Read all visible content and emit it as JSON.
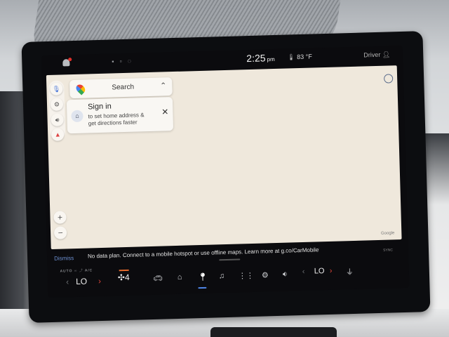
{
  "status": {
    "time": "2:25",
    "ampm": "pm",
    "temperature": "83 °F",
    "profile": "Driver"
  },
  "search": {
    "label": "Search"
  },
  "signin": {
    "title": "Sign in",
    "text": "to set home address & get directions faster"
  },
  "map": {
    "watermark": "Google"
  },
  "notice": {
    "dismiss": "Dismiss",
    "text": "No data plan. Connect to a mobile hotspot or use offline maps. Learn more at g.co/CarMobileData",
    "sync": "SYNC"
  },
  "climate": {
    "left_temp": "LO",
    "right_temp": "LO",
    "fan_level": "4",
    "auto_label": "AUTO",
    "ac_label": "A/C"
  }
}
